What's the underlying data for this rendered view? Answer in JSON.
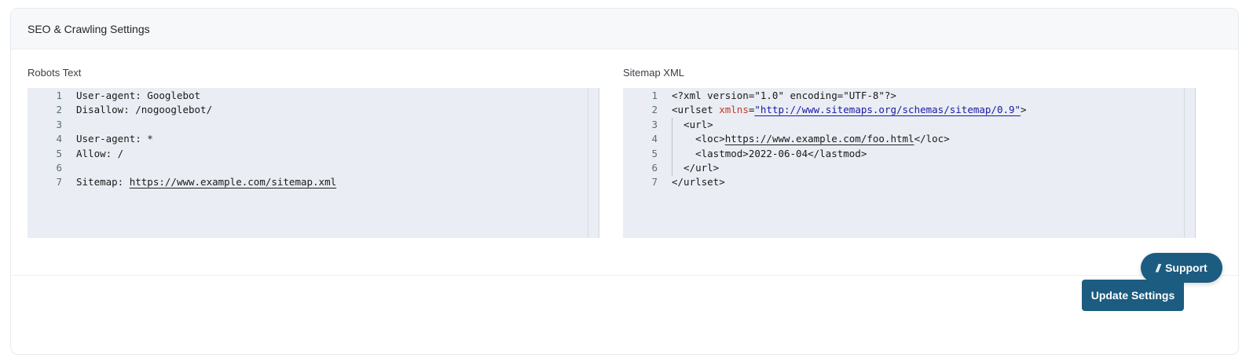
{
  "card": {
    "title": "SEO & Crawling Settings"
  },
  "robots": {
    "label": "Robots Text",
    "lines": [
      {
        "n": "1",
        "text": "User-agent: Googlebot"
      },
      {
        "n": "2",
        "text": "Disallow: /nogooglebot/"
      },
      {
        "n": "3",
        "text": ""
      },
      {
        "n": "4",
        "text": "User-agent: *"
      },
      {
        "n": "5",
        "text": "Allow: /"
      },
      {
        "n": "6",
        "text": ""
      },
      {
        "n": "7",
        "prefix": "Sitemap: ",
        "url": "https://www.example.com/sitemap.xml"
      }
    ]
  },
  "sitemap": {
    "label": "Sitemap XML",
    "lines": [
      {
        "n": "1",
        "parts": [
          {
            "t": "<?xml version=\"1.0\" encoding=\"UTF-8\"?>",
            "k": "tag"
          }
        ]
      },
      {
        "n": "2",
        "parts": [
          {
            "t": "<urlset ",
            "k": "tag"
          },
          {
            "t": "xmlns",
            "k": "attr"
          },
          {
            "t": "=",
            "k": "tag"
          },
          {
            "t": "\"http://www.sitemaps.org/schemas/sitemap/0.9\"",
            "k": "str"
          },
          {
            "t": ">",
            "k": "tag"
          }
        ]
      },
      {
        "n": "3",
        "parts": [
          {
            "t": "  <url>",
            "k": "tag"
          }
        ]
      },
      {
        "n": "4",
        "parts": [
          {
            "t": "    <loc>",
            "k": "tag"
          },
          {
            "t": "https://www.example.com/foo.html",
            "k": "url"
          },
          {
            "t": "</loc>",
            "k": "tag"
          }
        ]
      },
      {
        "n": "5",
        "parts": [
          {
            "t": "    <lastmod>2022-06-04</lastmod>",
            "k": "tag"
          }
        ]
      },
      {
        "n": "6",
        "parts": [
          {
            "t": "  </url>",
            "k": "tag"
          }
        ]
      },
      {
        "n": "7",
        "parts": [
          {
            "t": "</urlset>",
            "k": "tag"
          }
        ]
      }
    ]
  },
  "actions": {
    "update_label": "Update Settings"
  },
  "support": {
    "icon": "//",
    "label": "Support"
  },
  "colors": {
    "primary": "#1b5c80",
    "editor_bg": "#eaedf3",
    "xml_attr": "#c0392b",
    "xml_string": "#1a1aa6"
  }
}
